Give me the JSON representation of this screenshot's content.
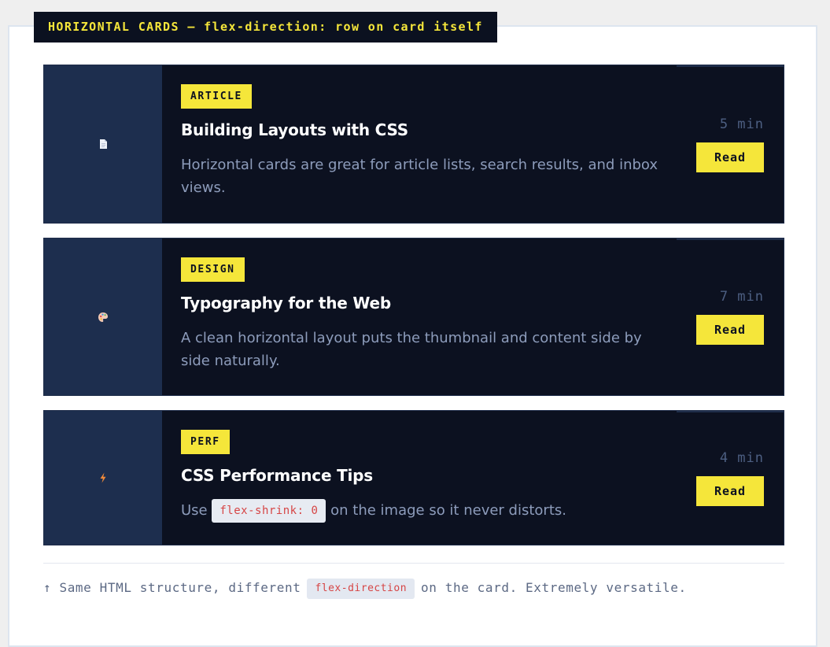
{
  "heading": "HORIZONTAL CARDS — flex-direction: row on card itself",
  "cards": [
    {
      "tag": "ARTICLE",
      "title": "Building Layouts with CSS",
      "description": "Horizontal cards are great for article lists, search results, and inbox views.",
      "duration": "5 min",
      "button": "Read",
      "icon": "document-icon"
    },
    {
      "tag": "DESIGN",
      "title": "Typography for the Web",
      "description": "A clean horizontal layout puts the thumbnail and content side by side naturally.",
      "duration": "7 min",
      "button": "Read",
      "icon": "palette-icon"
    },
    {
      "tag": "PERF",
      "title": "CSS Performance Tips",
      "desc_before": "Use",
      "desc_code": "flex-shrink: 0",
      "desc_after": "on the image so it never distorts.",
      "duration": "4 min",
      "button": "Read",
      "icon": "lightning-icon"
    }
  ],
  "footnote": {
    "before": "↑ Same HTML structure, different",
    "code": "flex-direction",
    "after": "on the card. Extremely versatile."
  },
  "colors": {
    "accent": "#f5e63a",
    "card_bg": "#0c1120",
    "thumb_bg": "#1d2e4e",
    "code_text": "#d64545"
  }
}
